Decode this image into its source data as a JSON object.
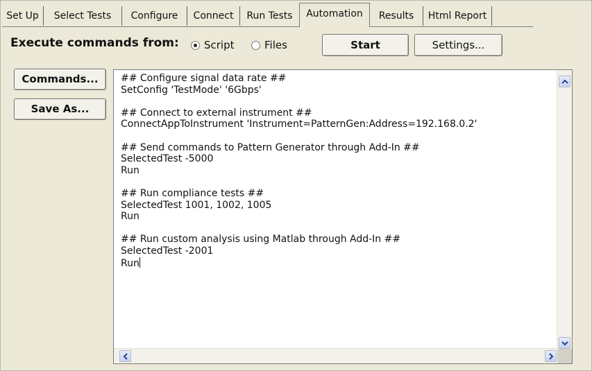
{
  "tabs": [
    {
      "label": "Set Up",
      "active": false
    },
    {
      "label": "Select Tests",
      "active": false
    },
    {
      "label": "Configure",
      "active": false
    },
    {
      "label": "Connect",
      "active": false
    },
    {
      "label": "Run Tests",
      "active": false
    },
    {
      "label": "Automation",
      "active": true
    },
    {
      "label": "Results",
      "active": false
    },
    {
      "label": "Html Report",
      "active": false
    }
  ],
  "execute": {
    "label": "Execute commands from:",
    "options": [
      {
        "label": "Script",
        "selected": true
      },
      {
        "label": "Files",
        "selected": false
      }
    ],
    "start_label": "Start",
    "settings_label": "Settings..."
  },
  "side_buttons": {
    "commands_label": "Commands...",
    "save_as_label": "Save As..."
  },
  "script_lines": [
    "## Configure signal data rate ##",
    "SetConfig 'TestMode' '6Gbps'",
    "",
    "## Connect to external instrument ##",
    "ConnectAppToInstrument 'Instrument=PatternGen:Address=192.168.0.2'",
    "",
    "## Send commands to Pattern Generator through Add-In ##",
    "SelectedTest -5000",
    "Run",
    "",
    "## Run compliance tests ##",
    "SelectedTest 1001, 1002, 1005",
    "Run",
    "",
    "## Run custom analysis using Matlab through Add-In ##",
    "SelectedTest -2001",
    "Run"
  ],
  "icons": {
    "scroll_up": "chevron-up-icon",
    "scroll_down": "chevron-down-icon",
    "scroll_left": "chevron-left-icon",
    "scroll_right": "chevron-right-icon"
  }
}
